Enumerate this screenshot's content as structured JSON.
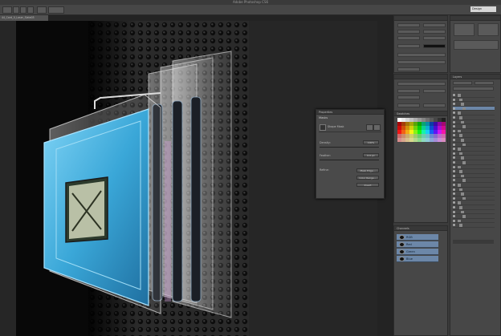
{
  "app": {
    "title": "Adobe Photoshop CS6"
  },
  "document": {
    "tab_label": "44_Card_0_Laser_Slate05"
  },
  "workspace": {
    "selected": "Design"
  },
  "panels": {
    "properties": {
      "title": "Properties",
      "section": "Masks",
      "mask_label": "Shape Mask"
    },
    "swatches": {
      "title": "Swatches"
    },
    "layers": {
      "title": "Layers",
      "blend": "Normal"
    },
    "channels": {
      "title": "Channels",
      "items": [
        "RGB",
        "Red",
        "Green",
        "Blue"
      ]
    }
  },
  "properties_float": {
    "title": "Properties",
    "section": "Masks",
    "mask_label": "Shape Mask",
    "density_label": "Density:",
    "density_value": "100%",
    "feather_label": "Feather:",
    "feather_value": "0.0 px",
    "refine_label": "Refine:",
    "buttons": [
      "Mask Edge...",
      "Color Range...",
      "Invert"
    ]
  },
  "colors": {
    "canvas_bg": "#262626",
    "panel_bg": "#474747",
    "channel_highlight": "#6c87a8",
    "card_blue": "#3aa7d8"
  }
}
